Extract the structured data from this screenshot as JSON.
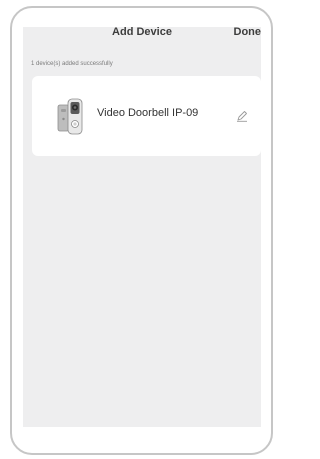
{
  "header": {
    "title": "Add Device",
    "done_label": "Done"
  },
  "status_text": "1 device(s) added successfully",
  "device": {
    "name": "Video Doorbell IP-09",
    "image_icon": "video-doorbell-icon",
    "edit_icon": "pencil-icon"
  }
}
